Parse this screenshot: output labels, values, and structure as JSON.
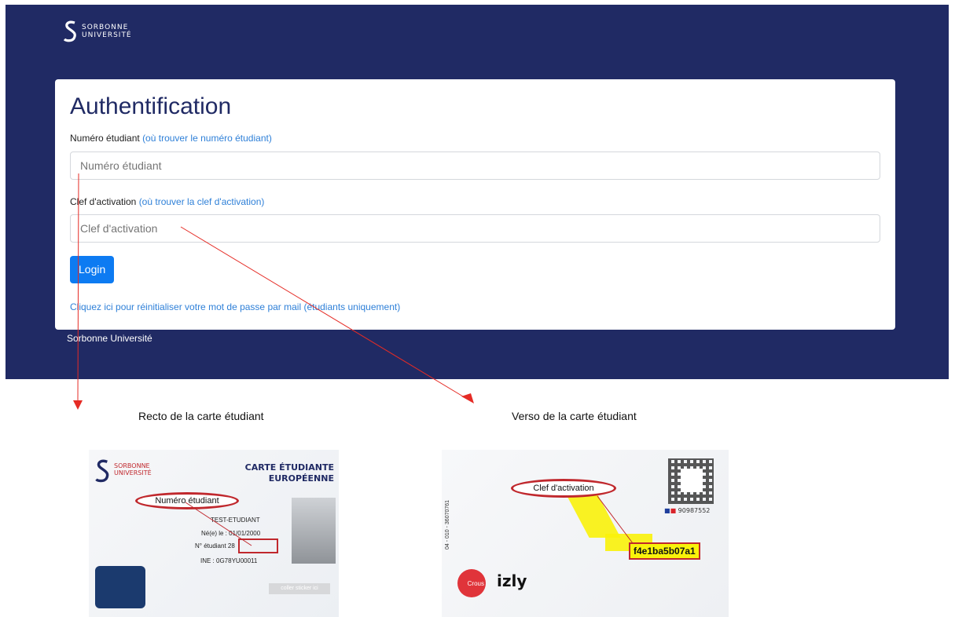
{
  "header": {
    "logo_line1": "SORBONNE",
    "logo_line2": "UNIVERSITÉ"
  },
  "form": {
    "title": "Authentification",
    "student_number_label": "Numéro étudiant",
    "student_number_help": "(où trouver le numéro étudiant)",
    "student_number_placeholder": "Numéro étudiant",
    "activation_label": "Clef d'activation",
    "activation_help": "(où trouver la clef d'activation)",
    "activation_placeholder": "Clef d'activation",
    "login_label": "Login",
    "reset_link": "Cliquez ici pour réinitialiser votre mot de passe par mail (étudiants uniquement)"
  },
  "footer": {
    "text": "Sorbonne Université"
  },
  "captions": {
    "recto": "Recto de la carte étudiant",
    "verso": "Verso de la carte étudiant"
  },
  "recto_card": {
    "logo_line1": "SORBONNE",
    "logo_line2": "UNIVERSITÉ",
    "title_line1": "CARTE ÉTUDIANTE",
    "title_line2": "EUROPÉENNE",
    "oval_label": "Numéro étudiant",
    "name": "TEST-ETUDIANT",
    "birth": "Né(e) le : 01/01/2000",
    "student_no": "N° étudiant 28",
    "ine": "INE : 0G78YU00011",
    "sticker": "coller sticker ici"
  },
  "verso_card": {
    "oval_label": "Clef d'activation",
    "code": "f4e1ba5b07a1",
    "flag_number": "90987552",
    "crous": "Crous",
    "izly": "izly",
    "vertical_text": "04 - 010 - 36070761"
  },
  "colors": {
    "banner": "#202a64",
    "link": "#2f80d8",
    "button": "#0d7bf2",
    "arrow": "#e52b25",
    "highlight": "#f9f20a"
  }
}
